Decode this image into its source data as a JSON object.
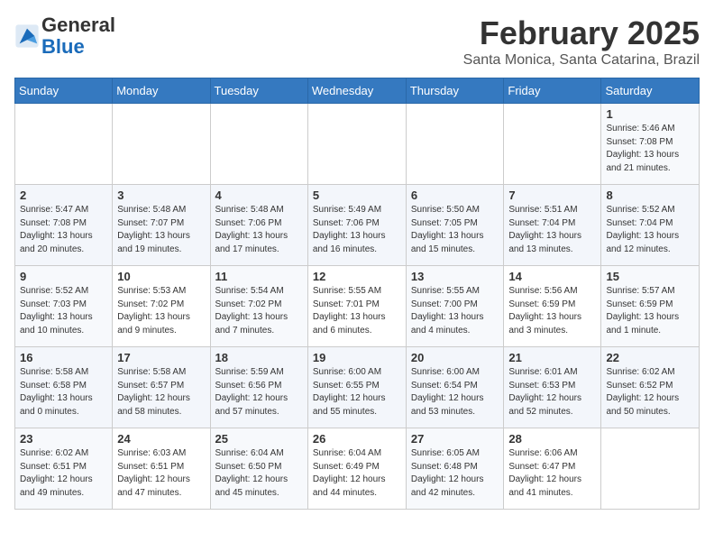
{
  "header": {
    "logo_line1": "General",
    "logo_line2": "Blue",
    "month_title": "February 2025",
    "location": "Santa Monica, Santa Catarina, Brazil"
  },
  "calendar": {
    "weekdays": [
      "Sunday",
      "Monday",
      "Tuesday",
      "Wednesday",
      "Thursday",
      "Friday",
      "Saturday"
    ],
    "weeks": [
      [
        {
          "day": "",
          "info": ""
        },
        {
          "day": "",
          "info": ""
        },
        {
          "day": "",
          "info": ""
        },
        {
          "day": "",
          "info": ""
        },
        {
          "day": "",
          "info": ""
        },
        {
          "day": "",
          "info": ""
        },
        {
          "day": "1",
          "info": "Sunrise: 5:46 AM\nSunset: 7:08 PM\nDaylight: 13 hours\nand 21 minutes."
        }
      ],
      [
        {
          "day": "2",
          "info": "Sunrise: 5:47 AM\nSunset: 7:08 PM\nDaylight: 13 hours\nand 20 minutes."
        },
        {
          "day": "3",
          "info": "Sunrise: 5:48 AM\nSunset: 7:07 PM\nDaylight: 13 hours\nand 19 minutes."
        },
        {
          "day": "4",
          "info": "Sunrise: 5:48 AM\nSunset: 7:06 PM\nDaylight: 13 hours\nand 17 minutes."
        },
        {
          "day": "5",
          "info": "Sunrise: 5:49 AM\nSunset: 7:06 PM\nDaylight: 13 hours\nand 16 minutes."
        },
        {
          "day": "6",
          "info": "Sunrise: 5:50 AM\nSunset: 7:05 PM\nDaylight: 13 hours\nand 15 minutes."
        },
        {
          "day": "7",
          "info": "Sunrise: 5:51 AM\nSunset: 7:04 PM\nDaylight: 13 hours\nand 13 minutes."
        },
        {
          "day": "8",
          "info": "Sunrise: 5:52 AM\nSunset: 7:04 PM\nDaylight: 13 hours\nand 12 minutes."
        }
      ],
      [
        {
          "day": "9",
          "info": "Sunrise: 5:52 AM\nSunset: 7:03 PM\nDaylight: 13 hours\nand 10 minutes."
        },
        {
          "day": "10",
          "info": "Sunrise: 5:53 AM\nSunset: 7:02 PM\nDaylight: 13 hours\nand 9 minutes."
        },
        {
          "day": "11",
          "info": "Sunrise: 5:54 AM\nSunset: 7:02 PM\nDaylight: 13 hours\nand 7 minutes."
        },
        {
          "day": "12",
          "info": "Sunrise: 5:55 AM\nSunset: 7:01 PM\nDaylight: 13 hours\nand 6 minutes."
        },
        {
          "day": "13",
          "info": "Sunrise: 5:55 AM\nSunset: 7:00 PM\nDaylight: 13 hours\nand 4 minutes."
        },
        {
          "day": "14",
          "info": "Sunrise: 5:56 AM\nSunset: 6:59 PM\nDaylight: 13 hours\nand 3 minutes."
        },
        {
          "day": "15",
          "info": "Sunrise: 5:57 AM\nSunset: 6:59 PM\nDaylight: 13 hours\nand 1 minute."
        }
      ],
      [
        {
          "day": "16",
          "info": "Sunrise: 5:58 AM\nSunset: 6:58 PM\nDaylight: 13 hours\nand 0 minutes."
        },
        {
          "day": "17",
          "info": "Sunrise: 5:58 AM\nSunset: 6:57 PM\nDaylight: 12 hours\nand 58 minutes."
        },
        {
          "day": "18",
          "info": "Sunrise: 5:59 AM\nSunset: 6:56 PM\nDaylight: 12 hours\nand 57 minutes."
        },
        {
          "day": "19",
          "info": "Sunrise: 6:00 AM\nSunset: 6:55 PM\nDaylight: 12 hours\nand 55 minutes."
        },
        {
          "day": "20",
          "info": "Sunrise: 6:00 AM\nSunset: 6:54 PM\nDaylight: 12 hours\nand 53 minutes."
        },
        {
          "day": "21",
          "info": "Sunrise: 6:01 AM\nSunset: 6:53 PM\nDaylight: 12 hours\nand 52 minutes."
        },
        {
          "day": "22",
          "info": "Sunrise: 6:02 AM\nSunset: 6:52 PM\nDaylight: 12 hours\nand 50 minutes."
        }
      ],
      [
        {
          "day": "23",
          "info": "Sunrise: 6:02 AM\nSunset: 6:51 PM\nDaylight: 12 hours\nand 49 minutes."
        },
        {
          "day": "24",
          "info": "Sunrise: 6:03 AM\nSunset: 6:51 PM\nDaylight: 12 hours\nand 47 minutes."
        },
        {
          "day": "25",
          "info": "Sunrise: 6:04 AM\nSunset: 6:50 PM\nDaylight: 12 hours\nand 45 minutes."
        },
        {
          "day": "26",
          "info": "Sunrise: 6:04 AM\nSunset: 6:49 PM\nDaylight: 12 hours\nand 44 minutes."
        },
        {
          "day": "27",
          "info": "Sunrise: 6:05 AM\nSunset: 6:48 PM\nDaylight: 12 hours\nand 42 minutes."
        },
        {
          "day": "28",
          "info": "Sunrise: 6:06 AM\nSunset: 6:47 PM\nDaylight: 12 hours\nand 41 minutes."
        },
        {
          "day": "",
          "info": ""
        }
      ]
    ]
  }
}
